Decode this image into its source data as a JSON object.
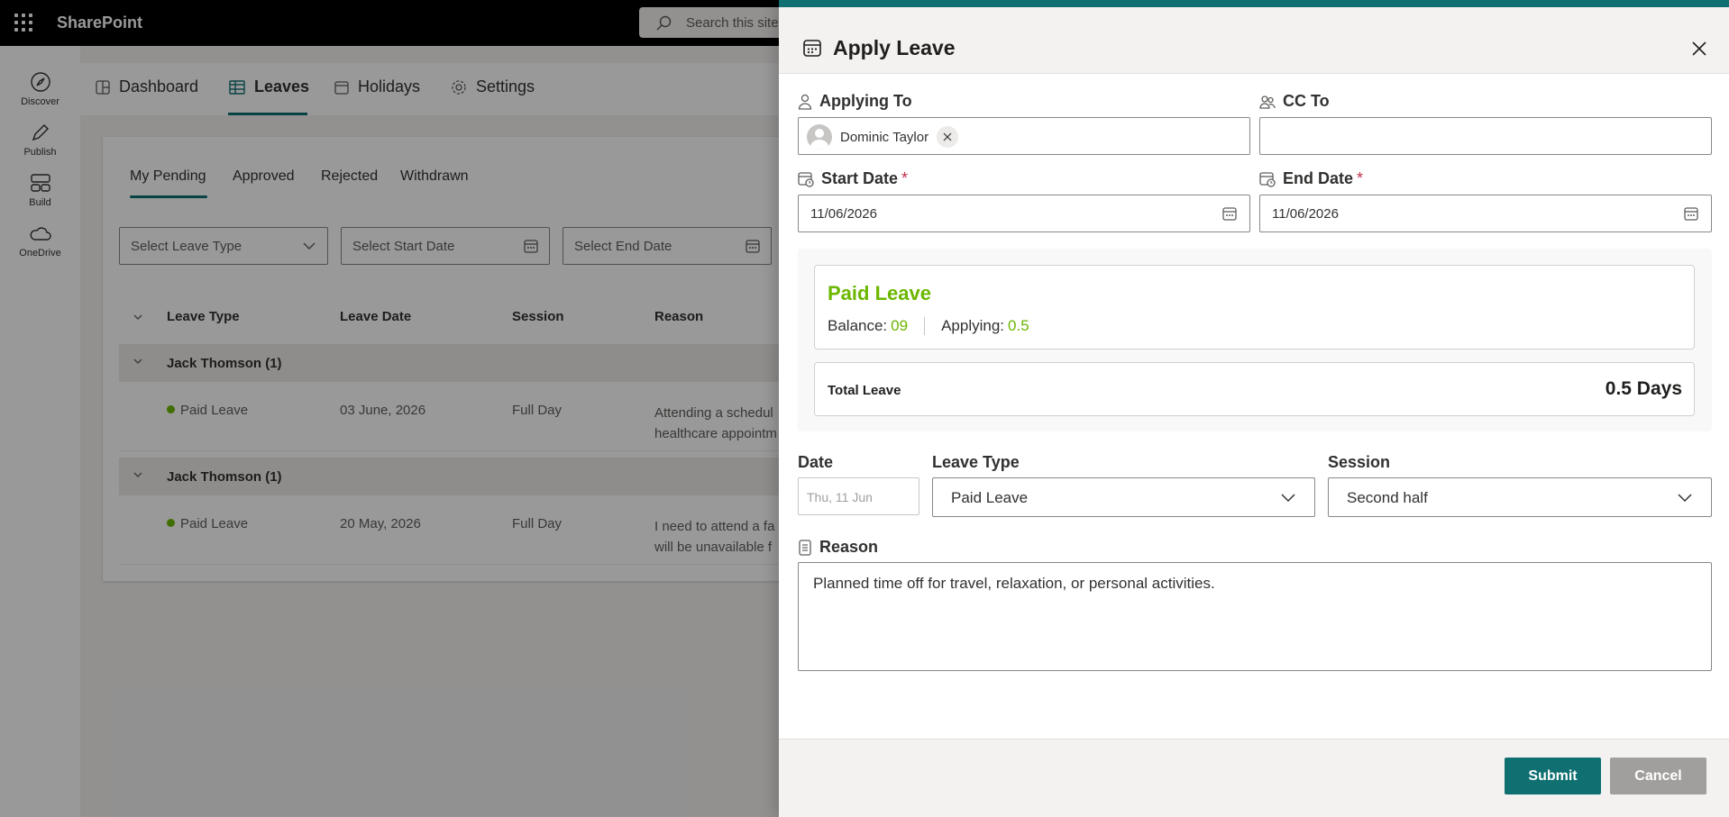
{
  "app": {
    "brand": "SharePoint",
    "search_placeholder": "Search this site"
  },
  "rail": [
    {
      "label": "Discover"
    },
    {
      "label": "Publish"
    },
    {
      "label": "Build"
    },
    {
      "label": "OneDrive"
    }
  ],
  "nav": {
    "tabs": [
      "Dashboard",
      "Leaves",
      "Holidays",
      "Settings"
    ],
    "active": "Leaves"
  },
  "leaves": {
    "subtabs": [
      "My Pending",
      "Approved",
      "Rejected",
      "Withdrawn"
    ],
    "filters": {
      "leave_type": "Select Leave Type",
      "start_date": "Select Start Date",
      "end_date": "Select End Date"
    },
    "columns": [
      "Leave Type",
      "Leave Date",
      "Session",
      "Reason"
    ],
    "groups": [
      {
        "title": "Jack Thomson (1)",
        "row": {
          "type": "Paid Leave",
          "date": "03 June, 2026",
          "session": "Full Day",
          "reason_line1": "Attending a schedul",
          "reason_line2": "healthcare appointm"
        }
      },
      {
        "title": "Jack Thomson (1)",
        "row": {
          "type": "Paid Leave",
          "date": "20 May, 2026",
          "session": "Full Day",
          "reason_line1": "I need to attend a fa",
          "reason_line2": "will be unavailable f"
        }
      }
    ]
  },
  "panel": {
    "title": "Apply Leave",
    "applying_to": {
      "label": "Applying To",
      "person": "Dominic Taylor"
    },
    "cc_to": {
      "label": "CC To",
      "value": ""
    },
    "start_date": {
      "label": "Start Date",
      "required": "*",
      "value": "11/06/2026"
    },
    "end_date": {
      "label": "End Date",
      "required": "*",
      "value": "11/06/2026"
    },
    "balance": {
      "title": "Paid Leave",
      "balance_label": "Balance:",
      "balance_value": "09",
      "applying_label": "Applying:",
      "applying_value": "0.5"
    },
    "total": {
      "label": "Total Leave",
      "value": "0.5 Days"
    },
    "row_labels": {
      "date": "Date",
      "leave_type": "Leave Type",
      "session": "Session"
    },
    "date_value": "Thu, 11 Jun",
    "leave_type_value": "Paid Leave",
    "session_value": "Second half",
    "reason": {
      "label": "Reason",
      "value": "Planned time off for travel, relaxation, or personal activities."
    },
    "buttons": {
      "submit": "Submit",
      "cancel": "Cancel"
    }
  },
  "colors": {
    "accent": "#0f6f71",
    "green": "#6bb700",
    "required": "#c4314b"
  }
}
